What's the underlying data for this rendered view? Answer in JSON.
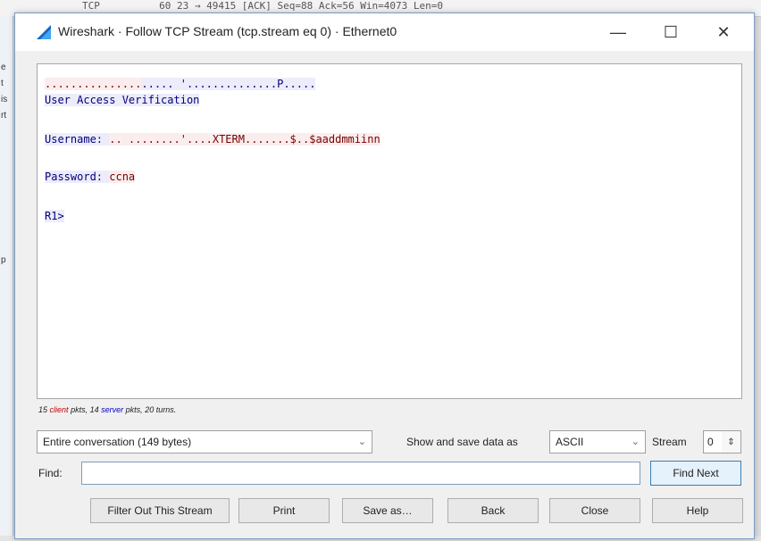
{
  "background": {
    "packet_row": "TCP          60 23 → 49415 [ACK] Seq=88 Ack=56 Win=4073 Len=0",
    "left_edge_letters": [
      "e",
      "t",
      "is",
      "rt",
      "p"
    ]
  },
  "window": {
    "title": "Wireshark · Follow TCP Stream (tcp.stream eq 0) · Ethernet0",
    "minimize_glyph": "—",
    "maximize_glyph": "☐",
    "close_glyph": "✕",
    "app_icon": "wireshark-fin-icon"
  },
  "stream": {
    "lines": [
      {
        "segments": [
          {
            "dir": "client",
            "text": "..............."
          },
          {
            "dir": "server",
            "text": "..... '..............P....."
          }
        ]
      },
      {
        "segments": [
          {
            "dir": "server",
            "text": "User Access Verification"
          }
        ]
      },
      {
        "segments": [
          {
            "dir": "server",
            "text": "Username: "
          },
          {
            "dir": "client",
            "text": ".. ........'....XTERM.......$..$aaddmmiinn"
          }
        ]
      },
      {
        "segments": [
          {
            "dir": "server",
            "text": "Password: "
          },
          {
            "dir": "client",
            "text": "ccna"
          }
        ]
      },
      {
        "segments": [
          {
            "dir": "server",
            "text": "R1>"
          }
        ]
      }
    ]
  },
  "stats": {
    "client_count": "15",
    "client_word": "client",
    "client_suffix": "pkts,",
    "server_count": "14",
    "server_word": "server",
    "server_suffix": "pkts,",
    "turns": "20 turns."
  },
  "controls": {
    "conversation_select": "Entire conversation (149 bytes)",
    "show_save_label": "Show and save data as",
    "format_select": "ASCII",
    "stream_label": "Stream",
    "stream_value": "0",
    "find_label": "Find:",
    "find_value": "",
    "find_next": "Find Next"
  },
  "buttons": {
    "filter_out": "Filter Out This Stream",
    "print": "Print",
    "save_as": "Save as…",
    "back": "Back",
    "close": "Close",
    "help": "Help"
  },
  "colors": {
    "client_text": "#7a0000",
    "client_bg": "#fbeded",
    "server_text": "#00007a",
    "server_bg": "#ececfb"
  }
}
